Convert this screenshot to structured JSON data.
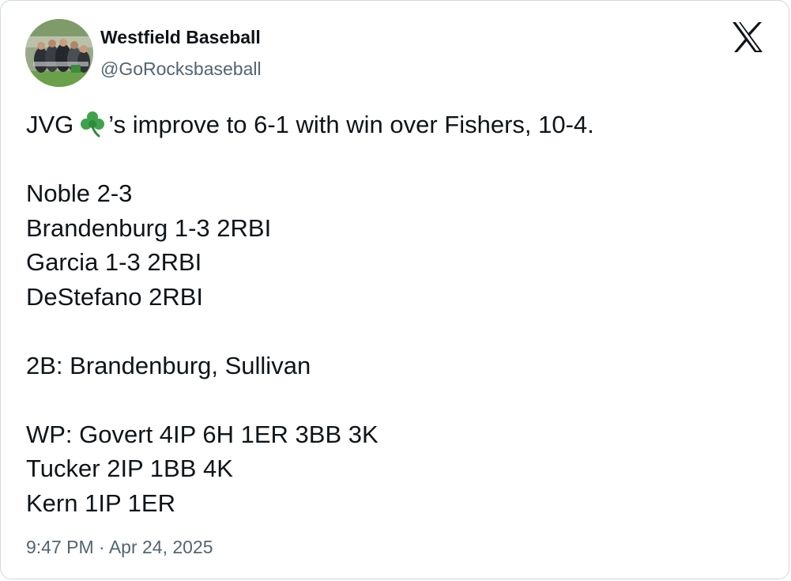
{
  "account": {
    "display_name": "Westfield Baseball",
    "handle": "@GoRocksbaseball",
    "avatar_icon": "team-photo-avatar"
  },
  "platform_icon": "x-logo-icon",
  "tweet": {
    "headline_prefix": "JVG",
    "headline_emoji": "shamrock-emoji",
    "headline_suffix": "’s improve to 6-1 with win over Fishers, 10-4.",
    "stats": {
      "noble": "Noble 2-3",
      "brandenburg": "Brandenburg 1-3 2RBI",
      "garcia": "Garcia 1-3 2RBI",
      "destefano": "DeStefano 2RBI"
    },
    "doubles": "2B: Brandenburg, Sullivan",
    "pitching": {
      "winner": "WP: Govert 4IP 6H 1ER 3BB 3K",
      "tucker": "Tucker 2IP 1BB 4K",
      "kern": "Kern 1IP 1ER"
    }
  },
  "timestamp": "9:47 PM · Apr 24, 2025",
  "colors": {
    "text_primary": "#0f1419",
    "text_secondary": "#536471",
    "border": "#cfd9de",
    "shamrock": "#3fa34d"
  }
}
